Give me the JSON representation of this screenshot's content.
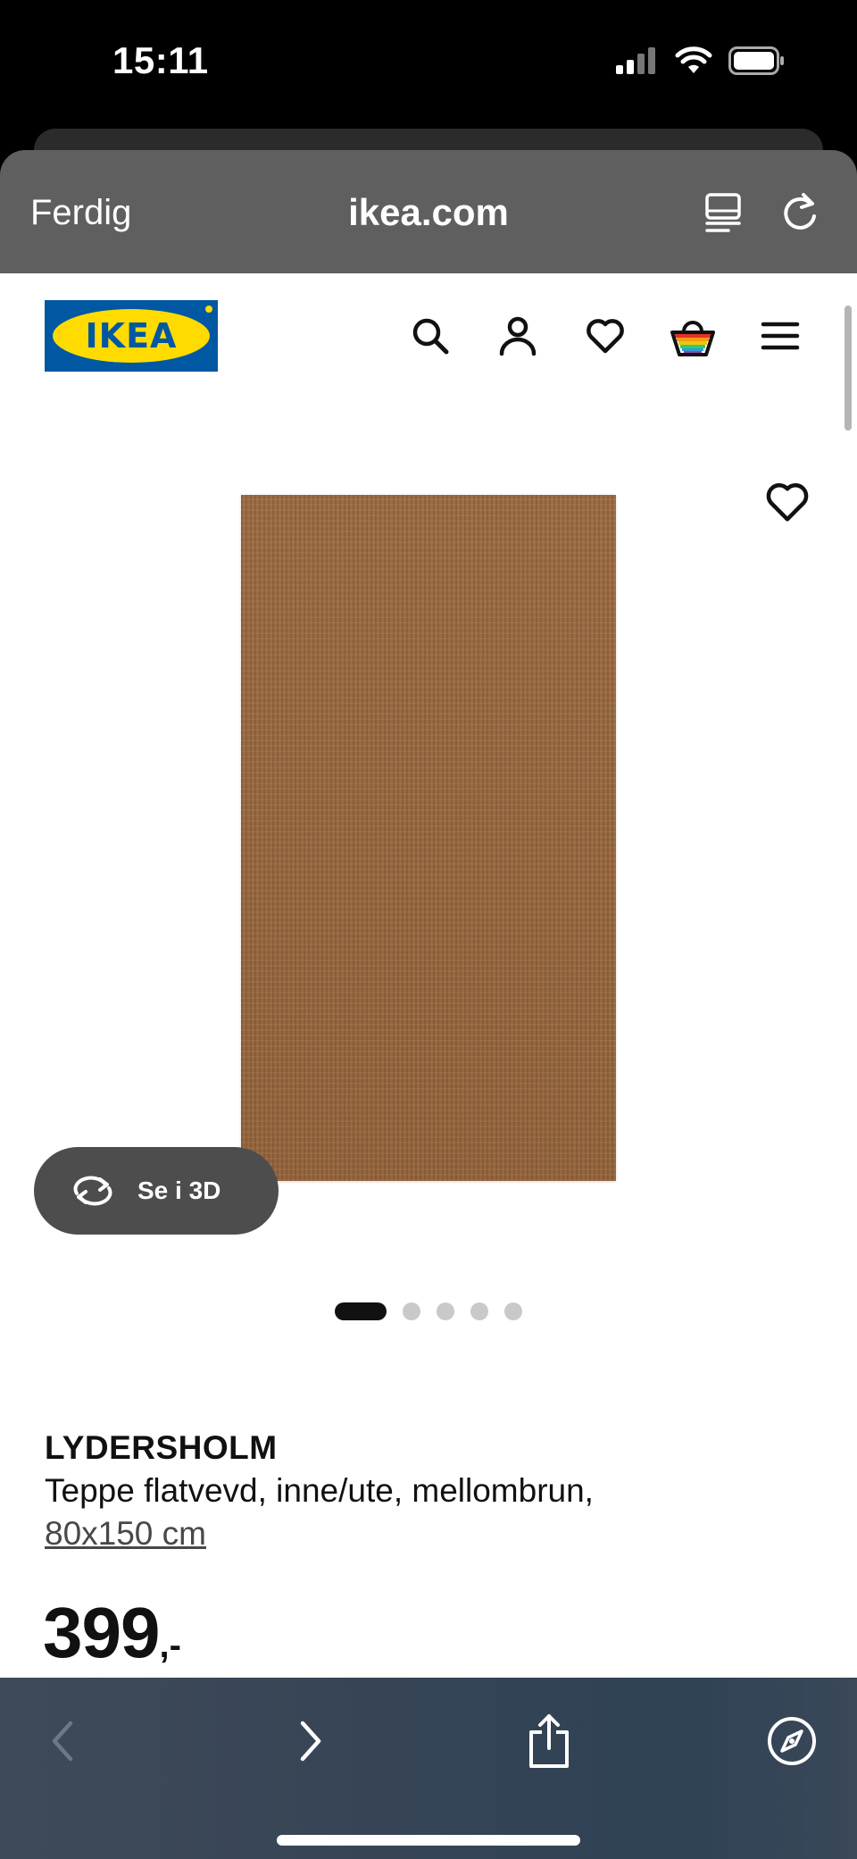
{
  "status_bar": {
    "time": "15:11",
    "icons": [
      "cellular-signal-icon",
      "wifi-icon",
      "battery-icon"
    ]
  },
  "browser": {
    "done_label": "Ferdig",
    "url": "ikea.com",
    "toolbar_icons": [
      "back-icon",
      "forward-icon",
      "share-icon",
      "compass-icon"
    ]
  },
  "site_header": {
    "logo_text": "IKEA",
    "icons": [
      "search-icon",
      "account-icon",
      "heart-icon",
      "cart-icon",
      "menu-icon"
    ]
  },
  "gallery": {
    "view_3d_label": "Se i 3D",
    "image_count": 5,
    "active_index": 0
  },
  "product": {
    "name": "LYDERSHOLM",
    "description": "Teppe flatvevd, inne/ute, mellombrun,",
    "size": "80x150 cm",
    "price": "399",
    "price_suffix": ",-"
  },
  "colors": {
    "ikea_blue": "#0058a3",
    "ikea_yellow": "#ffdb00",
    "rug_brown": "#9a6a42"
  }
}
